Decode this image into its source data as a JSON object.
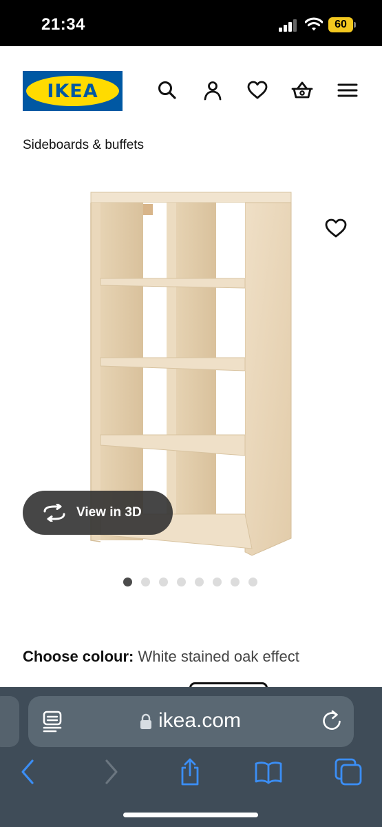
{
  "status_bar": {
    "time": "21:34",
    "battery_level": "60",
    "battery_color": "#f3c81f",
    "icons": [
      "signal-icon",
      "wifi-icon",
      "battery-icon"
    ]
  },
  "header": {
    "logo_text": "IKEA",
    "brand_colors": {
      "blue": "#0058a3",
      "yellow": "#ffdb00"
    },
    "icons": [
      "search-icon",
      "account-icon",
      "favourites-icon",
      "basket-icon",
      "menu-icon"
    ]
  },
  "breadcrumb": "Sideboards & buffets",
  "product": {
    "image": "shelving-unit-image",
    "view_3d_label": "View in 3D",
    "gallery": {
      "count": 8,
      "active_index": 0
    },
    "choose_colour_label": "Choose colour:",
    "colour_value": "White stained oak effect"
  },
  "browser": {
    "url": "ikea.com",
    "toolbar_icons": [
      "back-icon",
      "forward-icon",
      "share-icon",
      "bookmarks-icon",
      "tabs-icon"
    ]
  }
}
